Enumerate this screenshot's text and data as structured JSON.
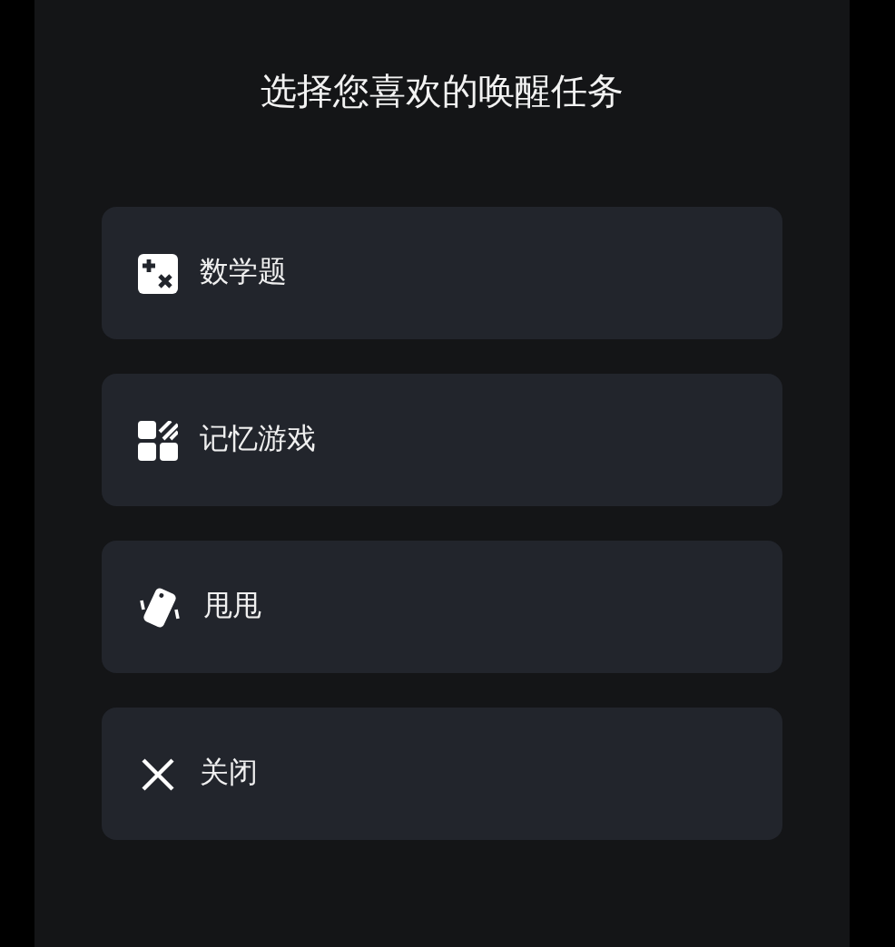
{
  "title": "选择您喜欢的唤醒任务",
  "options": [
    {
      "kind": "math",
      "label": "数学题"
    },
    {
      "kind": "memory",
      "label": "记忆游戏"
    },
    {
      "kind": "shake",
      "label": "甩甩"
    },
    {
      "kind": "close",
      "label": "关闭"
    }
  ]
}
